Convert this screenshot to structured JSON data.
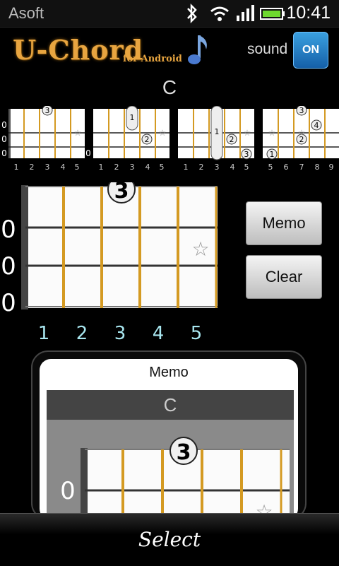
{
  "status_bar": {
    "carrier": "Asoft",
    "time": "10:41",
    "icons": [
      "bluetooth-icon",
      "wifi-icon",
      "signal-icon",
      "battery-icon"
    ]
  },
  "header": {
    "logo_main": "U-Chord",
    "logo_sub": "for Android",
    "sound_label": "sound",
    "sound_toggle": "ON"
  },
  "chord": {
    "name": "C"
  },
  "mini_diagrams": [
    {
      "open_strings": [
        "0",
        "0",
        "0"
      ],
      "frets": [
        "1",
        "2",
        "3",
        "4",
        "5"
      ]
    },
    {
      "open_strings": [
        "",
        "",
        "0"
      ],
      "frets": [
        "1",
        "2",
        "3",
        "4",
        "5"
      ]
    },
    {
      "open_strings": [
        "",
        "",
        ""
      ],
      "frets": [
        "1",
        "2",
        "3",
        "4",
        "5"
      ]
    },
    {
      "open_strings": [
        "",
        "",
        ""
      ],
      "frets": [
        "5",
        "6",
        "7",
        "8",
        "9"
      ]
    }
  ],
  "big_diagram": {
    "open_strings": [
      "0",
      "0",
      "0"
    ],
    "frets": [
      "1",
      "2",
      "3",
      "4",
      "5"
    ],
    "finger": "3"
  },
  "buttons": {
    "memo": "Memo",
    "clear": "Clear"
  },
  "memo_panel": {
    "title": "Memo",
    "chord_name": "C",
    "open_string": "0",
    "finger": "3"
  },
  "bottom_bar": {
    "select_label": "Select"
  }
}
